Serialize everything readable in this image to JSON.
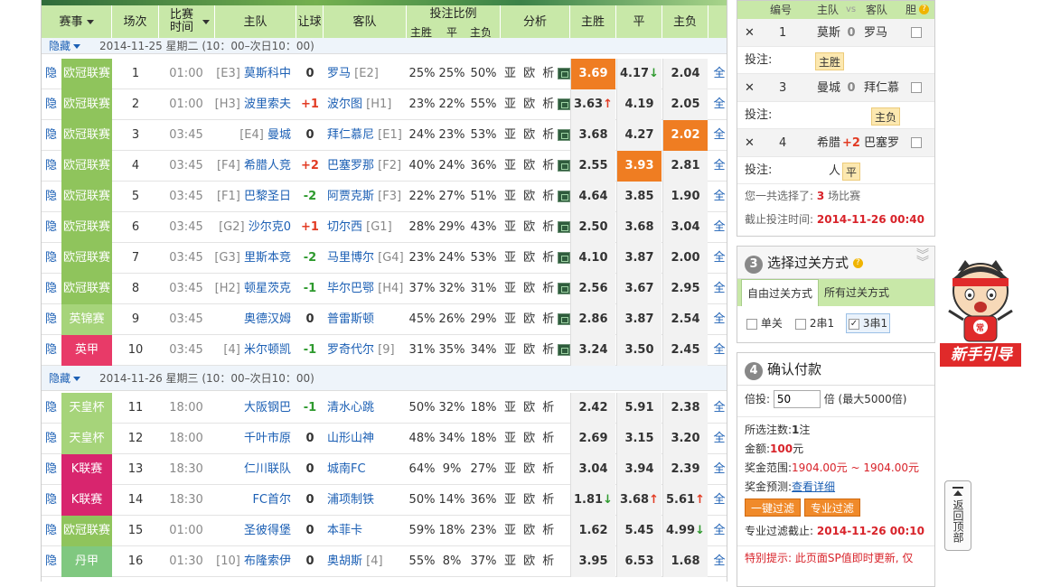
{
  "header": {
    "league": "赛事",
    "round": "场次",
    "time": "比赛\n时间",
    "home": "主队",
    "handicap": "让球",
    "away": "客队",
    "ratio": "投注比例",
    "ratio_sub": [
      "主胜",
      "平",
      "主负"
    ],
    "analysis": "分析",
    "win": "主胜",
    "draw": "平",
    "lose": "主负"
  },
  "date_rows": [
    {
      "hide": "隐藏",
      "text": "2014-11-25 星期二 (10：00–次日10：00)"
    },
    {
      "hide": "隐藏",
      "text": "2014-11-26 星期三 (10：00–次日10：00)"
    }
  ],
  "colors": {
    "ucl": "#8fc45c",
    "epl": "#e83a68",
    "eng": "#8fc45c",
    "emp": "#a6d47a",
    "k": "#d8256e",
    "dan": "#80c880",
    "accent": "#ef7d22"
  },
  "matches": [
    {
      "hide": "隐",
      "league": "欧冠联赛",
      "color": "#8fc45c",
      "no": "1",
      "time": "01:00",
      "home_rank": "[E3]",
      "home": "莫斯科中",
      "hc": "0",
      "away": "罗马",
      "away_rank": "[E2]",
      "p1": "25%",
      "p2": "25%",
      "p3": "50%",
      "an": "亚 欧 析",
      "o1": "3.69",
      "o2": "4.17",
      "o3": "2.04",
      "o1t": "",
      "o2t": "↓",
      "o3t": "",
      "hl": 1,
      "all": "全"
    },
    {
      "hide": "隐",
      "league": "欧冠联赛",
      "color": "#8fc45c",
      "no": "2",
      "time": "01:00",
      "home_rank": "[H3]",
      "home": "波里索夫",
      "hc": "+1",
      "away": "波尔图",
      "away_rank": "[H1]",
      "p1": "23%",
      "p2": "22%",
      "p3": "55%",
      "an": "亚 欧 析",
      "o1": "3.63",
      "o2": "4.19",
      "o3": "2.05",
      "o1t": "↑",
      "o2t": "",
      "o3t": "",
      "hl": 0,
      "all": "全"
    },
    {
      "hide": "隐",
      "league": "欧冠联赛",
      "color": "#8fc45c",
      "no": "3",
      "time": "03:45",
      "home_rank": "[E4]",
      "home": "曼城",
      "hc": "0",
      "away": "拜仁慕尼",
      "away_rank": "[E1]",
      "p1": "24%",
      "p2": "23%",
      "p3": "53%",
      "an": "亚 欧 析",
      "o1": "3.68",
      "o2": "4.27",
      "o3": "2.02",
      "o1t": "",
      "o2t": "",
      "o3t": "",
      "hl": 3,
      "all": "全"
    },
    {
      "hide": "隐",
      "league": "欧冠联赛",
      "color": "#8fc45c",
      "no": "4",
      "time": "03:45",
      "home_rank": "[F4]",
      "home": "希腊人竞",
      "hc": "+2",
      "away": "巴塞罗那",
      "away_rank": "[F2]",
      "p1": "40%",
      "p2": "24%",
      "p3": "36%",
      "an": "亚 欧 析",
      "o1": "2.55",
      "o2": "3.93",
      "o3": "2.81",
      "o1t": "",
      "o2t": "",
      "o3t": "",
      "hl": 2,
      "all": "全"
    },
    {
      "hide": "隐",
      "league": "欧冠联赛",
      "color": "#8fc45c",
      "no": "5",
      "time": "03:45",
      "home_rank": "[F1]",
      "home": "巴黎圣日",
      "hc": "-2",
      "away": "阿贾克斯",
      "away_rank": "[F3]",
      "p1": "22%",
      "p2": "27%",
      "p3": "51%",
      "an": "亚 欧 析",
      "o1": "4.64",
      "o2": "3.85",
      "o3": "1.90",
      "o1t": "",
      "o2t": "",
      "o3t": "",
      "hl": 0,
      "all": "全"
    },
    {
      "hide": "隐",
      "league": "欧冠联赛",
      "color": "#8fc45c",
      "no": "6",
      "time": "03:45",
      "home_rank": "[G2]",
      "home": "沙尔克0",
      "hc": "+1",
      "away": "切尔西",
      "away_rank": "[G1]",
      "p1": "28%",
      "p2": "29%",
      "p3": "43%",
      "an": "亚 欧 析",
      "o1": "2.50",
      "o2": "3.68",
      "o3": "3.04",
      "o1t": "",
      "o2t": "",
      "o3t": "",
      "hl": 0,
      "all": "全"
    },
    {
      "hide": "隐",
      "league": "欧冠联赛",
      "color": "#8fc45c",
      "no": "7",
      "time": "03:45",
      "home_rank": "[G3]",
      "home": "里斯本竞",
      "hc": "-2",
      "away": "马里博尔",
      "away_rank": "[G4]",
      "p1": "23%",
      "p2": "24%",
      "p3": "53%",
      "an": "亚 欧 析",
      "o1": "4.10",
      "o2": "3.87",
      "o3": "2.00",
      "o1t": "",
      "o2t": "",
      "o3t": "",
      "hl": 0,
      "all": "全"
    },
    {
      "hide": "隐",
      "league": "欧冠联赛",
      "color": "#8fc45c",
      "no": "8",
      "time": "03:45",
      "home_rank": "[H2]",
      "home": "顿星茨克",
      "hc": "-1",
      "away": "毕尔巴鄂",
      "away_rank": "[H4]",
      "p1": "37%",
      "p2": "32%",
      "p3": "31%",
      "an": "亚 欧 析",
      "o1": "2.56",
      "o2": "3.67",
      "o3": "2.95",
      "o1t": "",
      "o2t": "",
      "o3t": "",
      "hl": 0,
      "all": "全"
    },
    {
      "hide": "隐",
      "league": "英锦赛",
      "color": "#a6d47a",
      "no": "9",
      "time": "03:45",
      "home_rank": "",
      "home": "奥德汉姆",
      "hc": "0",
      "away": "普雷斯顿",
      "away_rank": "",
      "p1": "45%",
      "p2": "26%",
      "p3": "29%",
      "an": "亚 欧 析",
      "o1": "2.86",
      "o2": "3.87",
      "o3": "2.54",
      "o1t": "",
      "o2t": "",
      "o3t": "",
      "hl": 0,
      "all": "全"
    },
    {
      "hide": "隐",
      "league": "英甲",
      "color": "#e83a68",
      "no": "10",
      "time": "03:45",
      "home_rank": "[4]",
      "home": "米尔顿凯",
      "hc": "-1",
      "away": "罗奇代尔",
      "away_rank": "[9]",
      "p1": "31%",
      "p2": "35%",
      "p3": "34%",
      "an": "亚 欧 析",
      "o1": "3.24",
      "o2": "3.50",
      "o3": "2.45",
      "o1t": "",
      "o2t": "",
      "o3t": "",
      "hl": 0,
      "all": "全"
    },
    {
      "hide": "隐",
      "league": "天皇杯",
      "color": "#a6d47a",
      "no": "11",
      "time": "18:00",
      "home_rank": "",
      "home": "大阪钢巴",
      "hc": "-1",
      "away": "清水心跳",
      "away_rank": "",
      "p1": "50%",
      "p2": "32%",
      "p3": "18%",
      "an": "亚 欧 析",
      "o1": "2.42",
      "o2": "5.91",
      "o3": "2.38",
      "o1t": "",
      "o2t": "",
      "o3t": "",
      "hl": 0,
      "all": "全"
    },
    {
      "hide": "隐",
      "league": "天皇杯",
      "color": "#a6d47a",
      "no": "12",
      "time": "18:00",
      "home_rank": "",
      "home": "千叶市原",
      "hc": "0",
      "away": "山形山神",
      "away_rank": "",
      "p1": "48%",
      "p2": "34%",
      "p3": "18%",
      "an": "亚 欧 析",
      "o1": "2.69",
      "o2": "3.15",
      "o3": "3.20",
      "o1t": "",
      "o2t": "",
      "o3t": "",
      "hl": 0,
      "all": "全"
    },
    {
      "hide": "隐",
      "league": "K联赛",
      "color": "#d8256e",
      "no": "13",
      "time": "18:30",
      "home_rank": "",
      "home": "仁川联队",
      "hc": "0",
      "away": "城南FC",
      "away_rank": "",
      "p1": "64%",
      "p2": "9%",
      "p3": "27%",
      "an": "亚 欧 析",
      "o1": "3.04",
      "o2": "3.94",
      "o3": "2.39",
      "o1t": "",
      "o2t": "",
      "o3t": "",
      "hl": 0,
      "all": "全"
    },
    {
      "hide": "隐",
      "league": "K联赛",
      "color": "#d8256e",
      "no": "14",
      "time": "18:30",
      "home_rank": "",
      "home": "FC首尔",
      "hc": "0",
      "away": "浦项制铁",
      "away_rank": "",
      "p1": "50%",
      "p2": "14%",
      "p3": "36%",
      "an": "亚 欧 析",
      "o1": "1.81",
      "o2": "3.68",
      "o3": "5.61",
      "o1t": "↓",
      "o2t": "↑",
      "o3t": "↑",
      "hl": 0,
      "all": "全"
    },
    {
      "hide": "隐",
      "league": "欧冠联赛",
      "color": "#8fc45c",
      "no": "15",
      "time": "01:00",
      "home_rank": "",
      "home": "圣彼得堡",
      "hc": "0",
      "away": "本菲卡",
      "away_rank": "",
      "p1": "59%",
      "p2": "18%",
      "p3": "23%",
      "an": "亚 欧 析",
      "o1": "1.62",
      "o2": "5.45",
      "o3": "4.99",
      "o1t": "",
      "o2t": "",
      "o3t": "↓",
      "hl": 0,
      "all": "全"
    },
    {
      "hide": "隐",
      "league": "丹甲",
      "color": "#80c880",
      "no": "16",
      "time": "01:30",
      "home_rank": "[10]",
      "home": "布隆索伊",
      "hc": "0",
      "away": "奥胡斯",
      "away_rank": "[4]",
      "p1": "55%",
      "p2": "8%",
      "p3": "37%",
      "an": "亚 欧 析",
      "o1": "3.95",
      "o2": "6.53",
      "o3": "1.68",
      "o1t": "",
      "o2t": "",
      "o3t": "",
      "hl": 0,
      "all": "全"
    }
  ],
  "selection": {
    "header": [
      "编号",
      "主队",
      "vs",
      "客队",
      "胆"
    ],
    "items": [
      {
        "no": "1",
        "home": "莫斯科",
        "hc": "0",
        "away": "罗马",
        "bet_label": "投注:",
        "bet": "主胜"
      },
      {
        "no": "3",
        "home": "曼城",
        "hc": "0",
        "away": "拜仁慕",
        "bet_label": "投注:",
        "bet": "主负"
      },
      {
        "no": "4",
        "home": "希腊人",
        "hc": "+2",
        "away": "巴塞罗",
        "bet_label": "投注:",
        "bet": "平"
      }
    ],
    "summary_prefix": "您一共选择了:",
    "summary_count": "3",
    "summary_suffix": "场比赛",
    "deadline_label": "截止投注时间:",
    "deadline": "2014-11-26 00:40"
  },
  "pass": {
    "num": "3",
    "title": "选择过关方式",
    "tab_free": "自由过关方式",
    "tab_all": "所有过关方式",
    "opt1": "单关",
    "opt2": "2串1",
    "opt3": "3串1"
  },
  "pay": {
    "num": "4",
    "title": "确认付款",
    "mult_label": "倍投:",
    "mult_value": "50",
    "mult_suffix": "倍 (最大5000倍)",
    "count_label": "所选注数:",
    "count_value": "1",
    "count_unit": "注",
    "amount_label": "金额:",
    "amount_value": "100",
    "amount_unit": "元",
    "range_label": "奖金范围:",
    "range_value": "1904.00元 ~ 1904.00元",
    "predict_label": "奖金预测:",
    "predict_link": "查看详细",
    "btn1": "一键过滤",
    "btn2": "专业过滤",
    "pro_label": "专业过滤截止:",
    "pro_deadline": "2014-11-26 00:10",
    "tip": "特别提示: 此页面SP值即时更新, 仅"
  },
  "guide": {
    "text": "新手引导",
    "badge": "常"
  },
  "backtop": {
    "text": "返回顶部"
  }
}
